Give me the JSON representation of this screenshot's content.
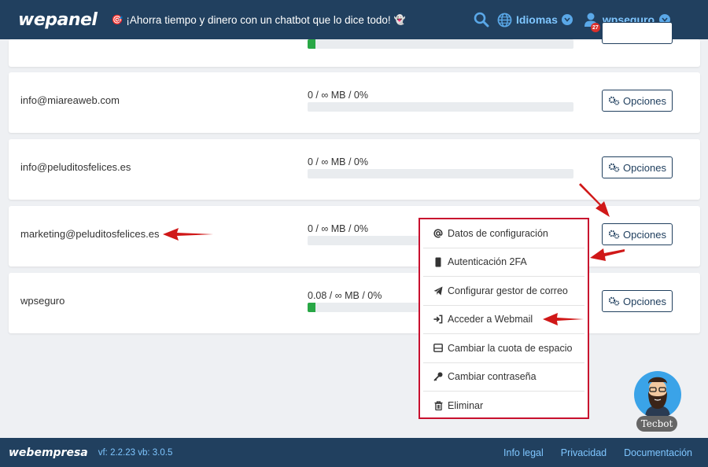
{
  "header": {
    "logo": "wepanel",
    "promo_emoji": "🎯",
    "promo_text": "¡Ahorra tiempo y dinero con un chatbot que lo dice todo!",
    "promo_emoji2": "👻",
    "languages_label": "Idiomas",
    "user_label": "wpseguro",
    "notification_count": "27",
    "icons": [
      "search-icon",
      "globe-icon",
      "user-icon",
      "chevron-down-icon"
    ]
  },
  "accounts": [
    {
      "email": "",
      "usage": "",
      "percent": 0.03
    },
    {
      "email": "info@miareaweb.com",
      "usage": "0 / ∞ MB / 0%",
      "percent": 0,
      "options_label": "Opciones"
    },
    {
      "email": "info@peluditosfelices.es",
      "usage": "0 / ∞ MB / 0%",
      "percent": 0,
      "options_label": "Opciones"
    },
    {
      "email": "marketing@peluditosfelices.es",
      "usage": "0 / ∞ MB / 0%",
      "percent": 0,
      "options_label": "Opciones"
    },
    {
      "email": "wpseguro",
      "usage": "0.08 / ∞ MB / 0%",
      "percent": 0.03,
      "options_label": "Opciones"
    }
  ],
  "menu": {
    "items": [
      {
        "label": "Datos de configuración",
        "icon": "at-icon"
      },
      {
        "label": "Autenticación 2FA",
        "icon": "mobile-icon"
      },
      {
        "label": "Configurar gestor de correo",
        "icon": "paper-plane-icon"
      },
      {
        "label": "Acceder a Webmail",
        "icon": "sign-in-icon"
      },
      {
        "label": "Cambiar la cuota de espacio",
        "icon": "hdd-icon"
      },
      {
        "label": "Cambiar contraseña",
        "icon": "key-icon"
      },
      {
        "label": "Eliminar",
        "icon": "trash-icon"
      }
    ]
  },
  "tecbot": {
    "label": "Tecbot"
  },
  "footer": {
    "logo": "webempresa",
    "version": "vf: 2.2.23 vb: 3.0.5",
    "links": [
      "Info legal",
      "Privacidad",
      "Documentación"
    ]
  },
  "colors": {
    "header_bg": "#21405f",
    "accent": "#7fc6ff",
    "highlight": "#c8102e",
    "progress": "#28a745"
  }
}
